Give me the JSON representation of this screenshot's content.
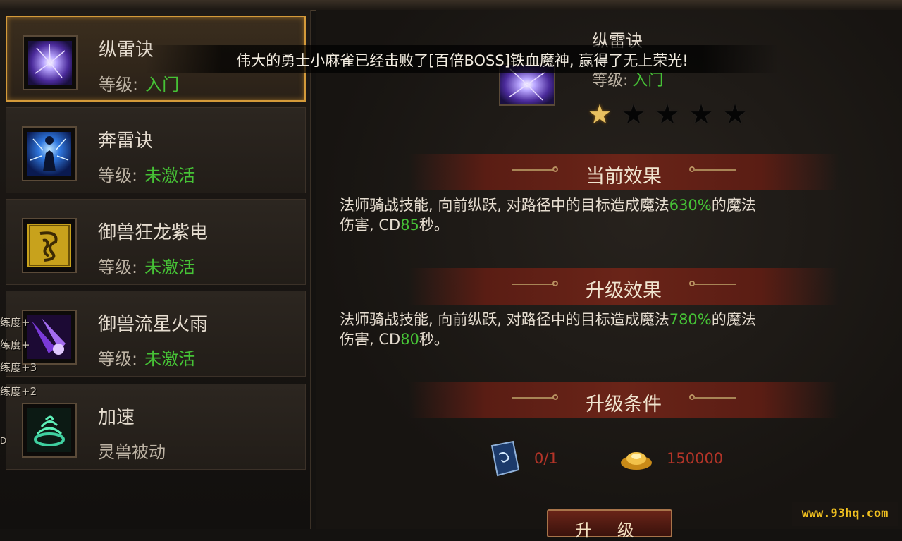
{
  "skills": [
    {
      "name": "纵雷诀",
      "level_label": "等级:",
      "level_value": "入门",
      "icon": "purple-lightning-orb-icon",
      "selected": true
    },
    {
      "name": "奔雷诀",
      "level_label": "等级:",
      "level_value": "未激活",
      "icon": "blue-lightning-figure-icon"
    },
    {
      "name": "御兽狂龙紫电",
      "level_label": "等级:",
      "level_value": "未激活",
      "icon": "golden-dragon-rune-icon"
    },
    {
      "name": "御兽流星火雨",
      "level_label": "等级:",
      "level_value": "未激活",
      "icon": "purple-meteor-icon"
    },
    {
      "name": "加速",
      "sub_label": "灵兽被动",
      "icon": "green-swirl-cauldron-icon"
    }
  ],
  "side_tags": [
    "练度+",
    "练度+",
    "练度+3",
    "练度+2",
    "D"
  ],
  "detail": {
    "name": "纵雷诀",
    "level_label": "等级:",
    "level_value": "入门",
    "stars_on": 1,
    "stars_total": 5
  },
  "sections": {
    "current": {
      "title": "当前效果",
      "line1_pre": "法师骑战技能, 向前纵跃, 对路径中的目标造成魔法",
      "line1_val": "630%",
      "line1_post": "的魔法",
      "line2_pre": "伤害, CD",
      "line2_val": "85",
      "line2_post": "秒。"
    },
    "upgrade": {
      "title": "升级效果",
      "line1_pre": "法师骑战技能, 向前纵跃, 对路径中的目标造成魔法",
      "line1_val": "780%",
      "line1_post": "的魔法",
      "line2_pre": "伤害, CD",
      "line2_val": "80",
      "line2_post": "秒。"
    },
    "requirements": {
      "title": "升级条件",
      "book_count": "0/1",
      "gold_amount": "150000"
    }
  },
  "upgrade_button": "升 级",
  "broadcast": "伟大的勇士小麻雀已经击败了[百倍BOSS]铁血魔神, 赢得了无上荣光!",
  "watermark": "www.93hq.com"
}
